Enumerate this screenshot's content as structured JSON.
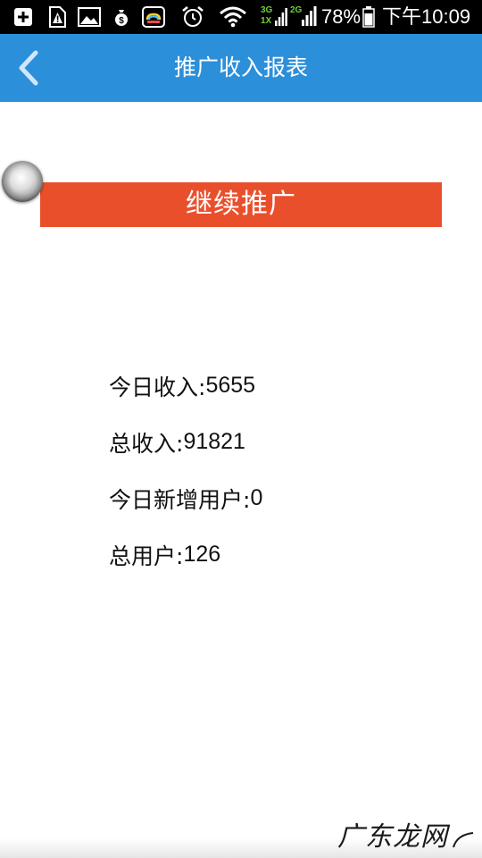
{
  "status_bar": {
    "icons": [
      "add-box-icon",
      "sim-warning-icon",
      "gallery-icon",
      "money-bag-icon",
      "cloud-app-icon",
      "alarm-icon",
      "wifi-icon",
      "signal-3g-icon",
      "signal-2g-icon",
      "battery-icon"
    ],
    "network_3g_top": "3G",
    "network_3g_bottom": "1X",
    "network_2g": "2G",
    "battery": "78%",
    "time": "下午10:09"
  },
  "app_bar": {
    "title": "推广收入报表",
    "back_icon": "chevron-left-icon",
    "color": "#2c8fd9"
  },
  "promote_button": {
    "label": "继续推广",
    "color": "#ea4f2c"
  },
  "stats": [
    {
      "label": "今日收入:",
      "value": "5655"
    },
    {
      "label": "总收入:",
      "value": "91821"
    },
    {
      "label": "今日新增用户:",
      "value": "0"
    },
    {
      "label": "总用户:",
      "value": "126"
    }
  ],
  "watermark": {
    "text": "广东龙网"
  }
}
